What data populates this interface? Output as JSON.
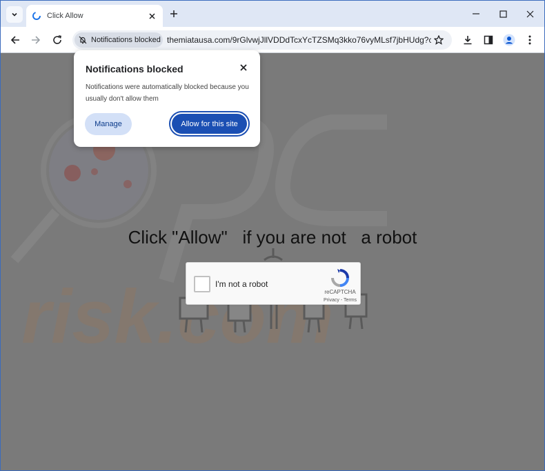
{
  "tab": {
    "title": "Click Allow"
  },
  "toolbar": {
    "permission_chip": "Notifications blocked",
    "url": "themiatausa.com/9rGlvwjJllVDDdTcxYcTZSMq3kko76vyMLsf7jbHUdg?ci..."
  },
  "popup": {
    "title": "Notifications blocked",
    "body": "Notifications were automatically blocked because you usually don't allow them",
    "manage_label": "Manage",
    "allow_label": "Allow for this site"
  },
  "page": {
    "headline_part1": "Click \"Allow\"",
    "headline_part2": "if you are not",
    "headline_part3": "a robot"
  },
  "captcha": {
    "label": "I'm not a robot",
    "brand": "reCAPTCHA",
    "links": "Privacy - Terms"
  },
  "colors": {
    "accent": "#1b4fb3",
    "overlay": "#7a7a7a",
    "window_frame": "#dfe7f5"
  }
}
